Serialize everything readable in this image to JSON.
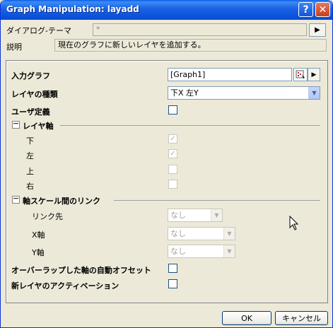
{
  "window": {
    "title": "Graph Manipulation: layadd",
    "help_glyph": "?",
    "close_glyph": "✕"
  },
  "theme": {
    "label": "ダイアログ-テーマ",
    "value": "*",
    "arrow_glyph": "▶"
  },
  "description": {
    "label": "説明",
    "text": "現在のグラフに新しいレイヤを追加する。"
  },
  "form": {
    "input_graph_label": "入力グラフ",
    "input_graph_value": "[Graph1]",
    "layer_type_label": "レイヤの種類",
    "layer_type_value": "下X 左Y",
    "user_defined_label": "ユーザ定義",
    "layer_axes": {
      "toggle": "－",
      "title": "レイヤ軸",
      "items": [
        {
          "label": "下",
          "checked": true
        },
        {
          "label": "左",
          "checked": true
        },
        {
          "label": "上",
          "checked": false
        },
        {
          "label": "右",
          "checked": false
        }
      ]
    },
    "scale_link": {
      "toggle": "－",
      "title": "軸スケール間のリンク",
      "link_to_label": "リンク先",
      "link_to_value": "なし",
      "x_axis_label": "X軸",
      "x_axis_value": "なし",
      "y_axis_label": "Y軸",
      "y_axis_value": "なし"
    },
    "auto_offset_label": "オーバーラップした軸の自動オフセット",
    "activate_label": "新レイヤのアクティベーション"
  },
  "buttons": {
    "ok": "OK",
    "cancel": "キャンセル"
  },
  "glyphs": {
    "check": "✓",
    "dropdown": "▼",
    "arrow_right": "▶"
  },
  "colors": {
    "titlebar": "#0a5fe6",
    "dialog_bg": "#ece9d8",
    "field_border": "#7f9db9"
  }
}
